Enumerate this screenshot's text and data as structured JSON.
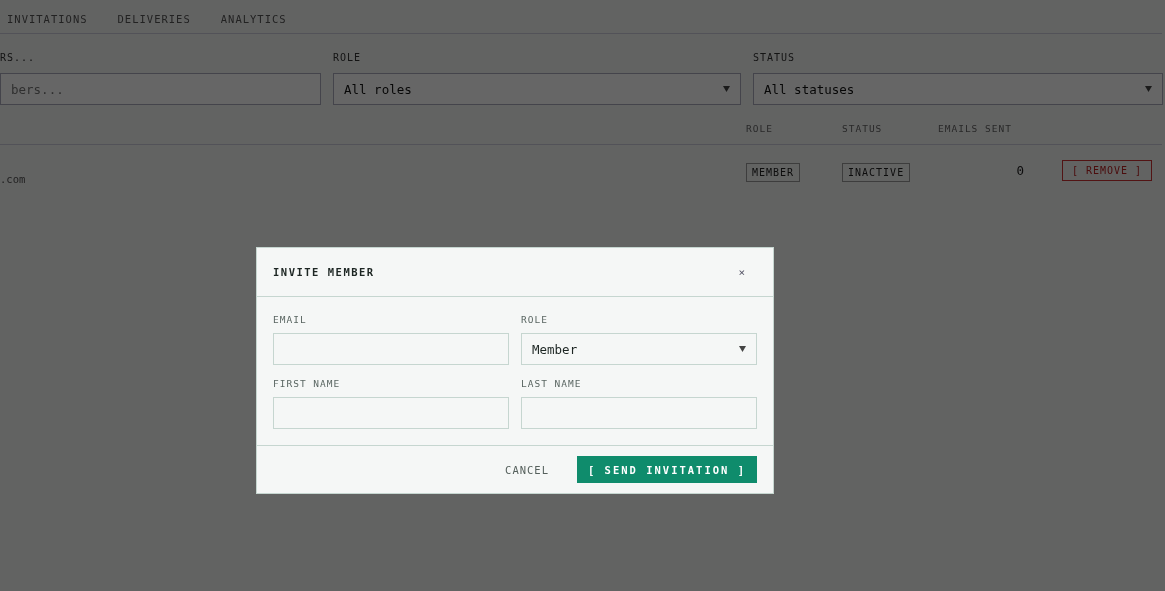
{
  "tabs": [
    {
      "label": "INVITATIONS"
    },
    {
      "label": "DELIVERIES"
    },
    {
      "label": "ANALYTICS"
    }
  ],
  "filters": {
    "search": {
      "label": "RS...",
      "placeholder": "bers..."
    },
    "role": {
      "label": "ROLE",
      "value": "All roles"
    },
    "status": {
      "label": "STATUS",
      "value": "All statuses"
    }
  },
  "table": {
    "columns": [
      "ROLE",
      "STATUS",
      "EMAILS SENT"
    ],
    "rows": [
      {
        "email": ".com",
        "role": "MEMBER",
        "status": "INACTIVE",
        "emails_sent": "0",
        "action": "[ REMOVE ]"
      }
    ]
  },
  "dialog": {
    "title": "INVITE MEMBER",
    "close": "×",
    "fields": [
      {
        "label": "EMAIL",
        "kind": "text"
      },
      {
        "label": "ROLE",
        "kind": "select",
        "value": "Member"
      },
      {
        "label": "FIRST NAME",
        "kind": "text"
      },
      {
        "label": "LAST NAME",
        "kind": "text"
      }
    ],
    "cancel": "CANCEL",
    "submit": "[ SEND INVITATION ]"
  }
}
